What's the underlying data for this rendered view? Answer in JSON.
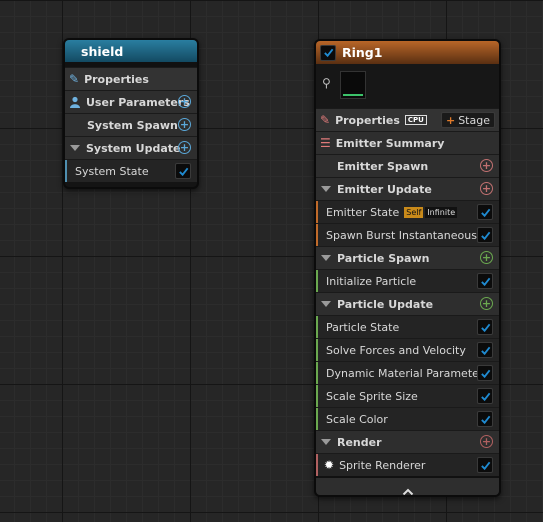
{
  "shield": {
    "title": "shield",
    "properties": "Properties",
    "user_parameters": "User Parameters",
    "system_spawn": "System Spawn",
    "system_update": "System Update",
    "system_state": "System State"
  },
  "ring": {
    "title": "Ring1",
    "properties": "Properties",
    "cpu_badge": "CPU",
    "stage_button": "Stage",
    "emitter_summary": "Emitter Summary",
    "emitter_spawn": "Emitter Spawn",
    "emitter_update": "Emitter Update",
    "emitter_state": "Emitter State",
    "self_tag": "Self",
    "infinite_tag": "Infinite",
    "spawn_burst": "Spawn Burst Instantaneous",
    "particle_spawn": "Particle Spawn",
    "initialize_particle": "Initialize Particle",
    "particle_update": "Particle Update",
    "particle_update_items": [
      "Particle State",
      "Solve Forces and Velocity",
      "Dynamic Material Parameters",
      "Scale Sprite Size",
      "Scale Color"
    ],
    "render": "Render",
    "sprite_renderer": "Sprite Renderer"
  },
  "colors": {
    "system_accent": "#4f8fb0",
    "emitter_accent": "#c06a2a",
    "spawn_green": "#6aa84f",
    "render_red": "#b06060",
    "check_blue": "#1f8ad0"
  }
}
